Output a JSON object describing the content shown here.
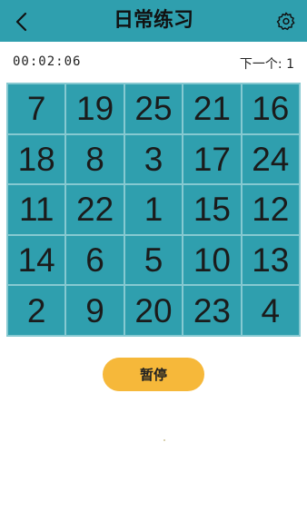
{
  "header": {
    "title": "日常练习",
    "back_icon": "back-chevron-icon",
    "settings_icon": "gear-icon"
  },
  "status": {
    "timer": "00:02:06",
    "next_label": "下一个:",
    "next_value": "1"
  },
  "grid": {
    "numbers": [
      "7",
      "19",
      "25",
      "21",
      "16",
      "18",
      "8",
      "3",
      "17",
      "24",
      "11",
      "22",
      "1",
      "15",
      "12",
      "14",
      "6",
      "5",
      "10",
      "13",
      "2",
      "9",
      "20",
      "23",
      "4"
    ]
  },
  "controls": {
    "pause_label": "暂停"
  },
  "colors": {
    "header_bg": "#2f9fae",
    "cell_bg": "#2f9fae",
    "grid_lines": "#86c9d1",
    "pause_bg": "#f6b83a"
  }
}
